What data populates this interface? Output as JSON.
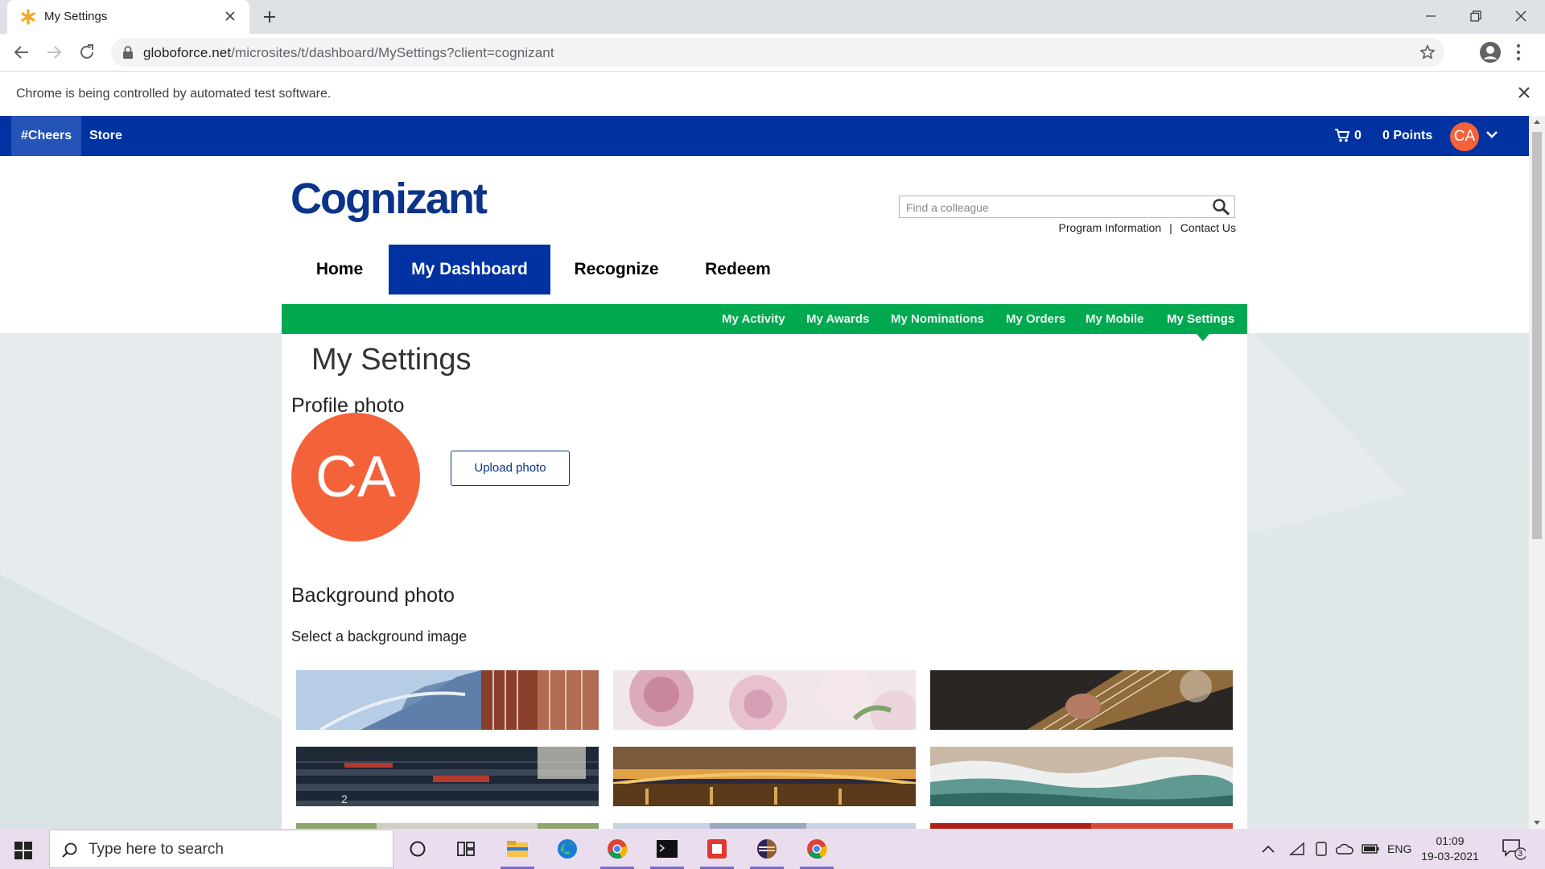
{
  "browser": {
    "tab_title": "My Settings",
    "url_domain": "globoforce.net",
    "url_path": "/microsites/t/dashboard/MySettings?client=cognizant",
    "automation_notice": "Chrome is being controlled by automated test software."
  },
  "topbar": {
    "cheers": "#Cheers",
    "store": "Store",
    "cart_count": "0",
    "points": "0 Points",
    "avatar_initials": "CA"
  },
  "header": {
    "logo": "Cognizant",
    "search_placeholder": "Find a colleague",
    "program_info": "Program Information",
    "separator": "|",
    "contact_us": "Contact Us"
  },
  "nav": {
    "items": [
      "Home",
      "My Dashboard",
      "Recognize",
      "Redeem"
    ],
    "active": "My Dashboard"
  },
  "subnav": {
    "items": [
      "My Activity",
      "My Awards",
      "My Nominations",
      "My Orders",
      "My Mobile",
      "My Settings"
    ],
    "active": "My Settings"
  },
  "content": {
    "title": "My Settings",
    "profile_heading": "Profile photo",
    "avatar_initials": "CA",
    "upload_button": "Upload photo",
    "background_heading": "Background photo",
    "background_subtitle": "Select a background image",
    "background_images": [
      "city-building",
      "pink-roses",
      "guitar",
      "stadium-seats",
      "bridge-at-night",
      "ocean-wave"
    ]
  },
  "taskbar": {
    "search_placeholder": "Type here to search",
    "language": "ENG",
    "time": "01:09",
    "date": "19-03-2021",
    "notification_count": "3"
  },
  "colors": {
    "brand_blue": "#0033a1",
    "subnav_green": "#00a94f",
    "avatar_orange": "#f4623a",
    "logo_navy": "#0a3389"
  }
}
